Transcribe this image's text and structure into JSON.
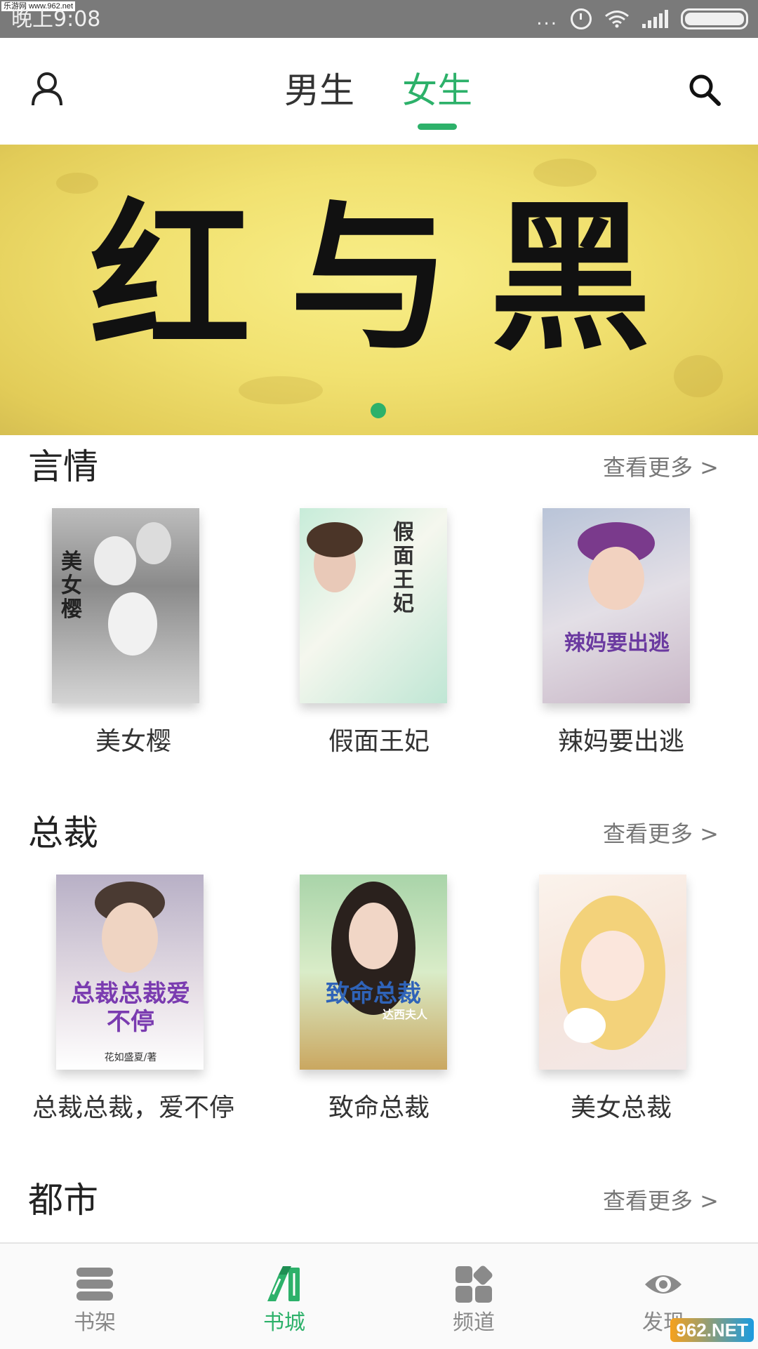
{
  "status_bar": {
    "watermark": "乐游网 www.962.net",
    "time": "晚上9:08",
    "dots": "..."
  },
  "header": {
    "tabs": [
      {
        "label": "男生",
        "active": false
      },
      {
        "label": "女生",
        "active": true
      }
    ],
    "accent_color": "#2db16a"
  },
  "banner": {
    "title": "红与黑",
    "pages": 1,
    "current_page": 1
  },
  "sections": [
    {
      "title": "言情",
      "more_label": "查看更多 >",
      "books": [
        {
          "title": "美女樱",
          "cover_text": "美女樱"
        },
        {
          "title": "假面王妃",
          "cover_text": "假面王妃"
        },
        {
          "title": "辣妈要出逃",
          "cover_text": "辣妈要出逃"
        }
      ]
    },
    {
      "title": "总裁",
      "more_label": "查看更多 >",
      "books": [
        {
          "title": "总裁总裁，爱不停",
          "cover_text": "总裁总裁爱不停",
          "cover_author": "花如盛夏/著"
        },
        {
          "title": "致命总裁",
          "cover_text": "致命总裁",
          "cover_author": "达西夫人"
        },
        {
          "title": "美女总裁",
          "cover_text": ""
        }
      ]
    },
    {
      "title": "都市",
      "more_label": "查看更多 >",
      "books": []
    }
  ],
  "bottom_nav": [
    {
      "label": "书架",
      "icon": "bookshelf-icon",
      "active": false
    },
    {
      "label": "书城",
      "icon": "bookstore-icon",
      "active": true
    },
    {
      "label": "频道",
      "icon": "channels-grid-icon",
      "active": false
    },
    {
      "label": "发现",
      "icon": "eye-icon",
      "active": false
    }
  ],
  "bottom_watermark": "962.NET"
}
